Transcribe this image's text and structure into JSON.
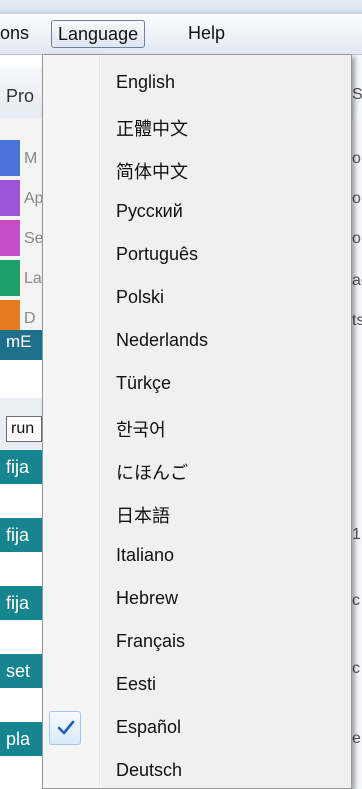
{
  "menubar": {
    "items": [
      {
        "label": "ons"
      },
      {
        "label": "Language"
      },
      {
        "label": "Help"
      }
    ]
  },
  "background": {
    "pro_label": "Pro",
    "category_letters": [
      "M",
      "Ap",
      "Se",
      "La",
      "D"
    ],
    "category_colors": [
      "#4a72d9",
      "#9b55d6",
      "#c54cc5",
      "#1e9e68",
      "#e57b1f"
    ],
    "blocks": [
      {
        "label": "mE"
      },
      {
        "label": "run"
      },
      {
        "label": "fija"
      },
      {
        "label": "fija"
      },
      {
        "label": "fija"
      },
      {
        "label": "set"
      },
      {
        "label": "pla"
      }
    ],
    "right_fragments": [
      "Se",
      "o",
      "o",
      "o",
      "ac",
      "ts",
      "1",
      "c",
      "c",
      "e"
    ]
  },
  "language_menu": {
    "items": [
      {
        "label": "English",
        "checked": false
      },
      {
        "label": "正體中文",
        "checked": false
      },
      {
        "label": "简体中文",
        "checked": false
      },
      {
        "label": "Русский",
        "checked": false
      },
      {
        "label": "Português",
        "checked": false
      },
      {
        "label": "Polski",
        "checked": false
      },
      {
        "label": "Nederlands",
        "checked": false
      },
      {
        "label": "Türkçe",
        "checked": false
      },
      {
        "label": "한국어",
        "checked": false
      },
      {
        "label": "にほんご",
        "checked": false
      },
      {
        "label": "日本語",
        "checked": false
      },
      {
        "label": "Italiano",
        "checked": false
      },
      {
        "label": "Hebrew",
        "checked": false
      },
      {
        "label": "Français",
        "checked": false
      },
      {
        "label": "Eesti",
        "checked": false
      },
      {
        "label": "Español",
        "checked": true
      },
      {
        "label": "Deutsch",
        "checked": false
      }
    ],
    "check_color": "#1b5fbf"
  }
}
